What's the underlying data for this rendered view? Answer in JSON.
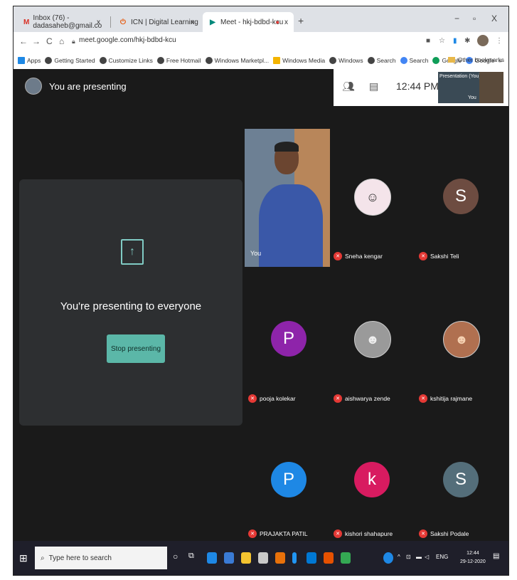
{
  "browser": {
    "tabs": [
      {
        "icon": "gmail-icon",
        "label": "Inbox (76) - dadasaheb@gmail.co",
        "close": "x"
      },
      {
        "icon": "icn-icon",
        "label": "ICN | Digital Learning",
        "close": "x"
      },
      {
        "icon": "meet-icon",
        "label": "Meet - hkj-bdbd-kcu",
        "close": "x"
      }
    ],
    "new_tab": "+",
    "window_controls": [
      "−",
      "▫",
      "X"
    ],
    "nav": {
      "back": "←",
      "forward": "→",
      "reload": "C",
      "home": "⌂"
    },
    "url": "meet.google.com/hkj-bdbd-kcu",
    "bookmarks": [
      "Apps",
      "Getting Started",
      "Customize Links",
      "Free Hotmail",
      "Windows Marketpl...",
      "Windows Media",
      "Windows",
      "Search",
      "Search",
      "Google",
      "Google"
    ],
    "bookmarks_more": "»",
    "other_bookmarks": "Other bookmarks"
  },
  "meet": {
    "presenting_status": "You are presenting",
    "time": "12:44 PM",
    "thumb_label": "Presentation (You)",
    "thumb_you": "You",
    "presenting_message": "You're presenting to everyone",
    "stop_button": "Stop presenting",
    "you_label": "You",
    "participants": [
      {
        "name": "Sneha kengar",
        "type": "photo",
        "color": "#f2e0e8"
      },
      {
        "name": "Sakshi Teli",
        "initial": "S",
        "color": "#6d4c41"
      },
      {
        "name": "pooja kolekar",
        "initial": "P",
        "color": "#8e24aa"
      },
      {
        "name": "aishwarya zende",
        "type": "photo",
        "color": "#8a8a8a"
      },
      {
        "name": "kshitija rajmane",
        "type": "photo",
        "color": "#b07050"
      },
      {
        "name": "PRAJAKTA PATIL",
        "initial": "P",
        "color": "#1e88e5"
      },
      {
        "name": "kishori shahapure",
        "initial": "k",
        "color": "#d81b60"
      },
      {
        "name": "Sakshi Podale",
        "initial": "S",
        "color": "#546e7a"
      }
    ]
  },
  "taskbar": {
    "search_placeholder": "Type here to search",
    "tray_lang": "ENG",
    "clock_time": "12:44",
    "clock_date": "29-12-2020"
  }
}
